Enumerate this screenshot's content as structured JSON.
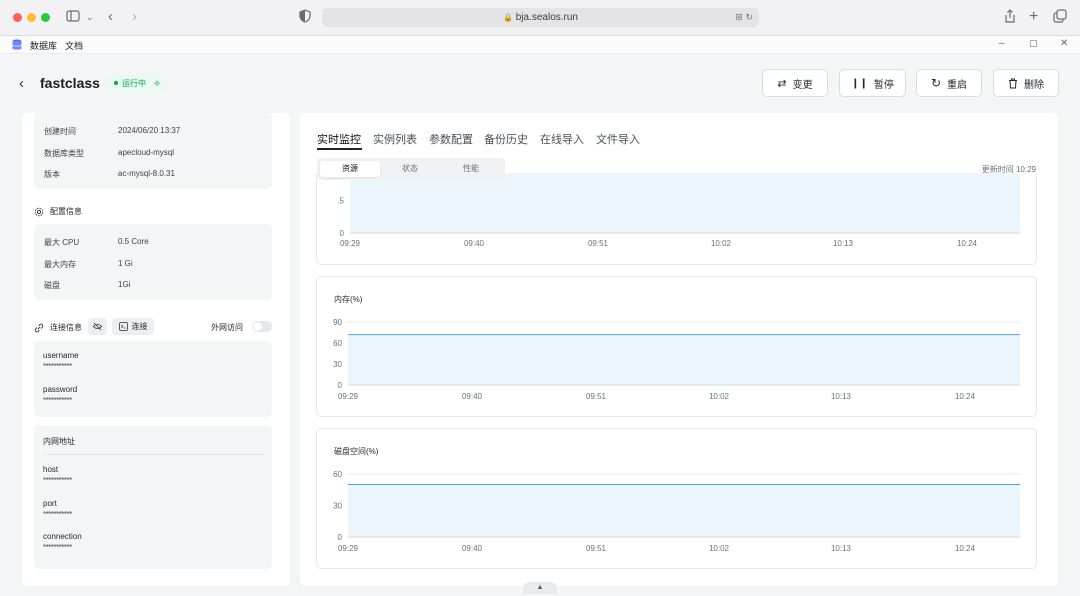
{
  "browser": {
    "url": "bja.sealos.run"
  },
  "appbar": {
    "tab1": "数据库",
    "tab2": "文档"
  },
  "header": {
    "title": "fastclass",
    "status": "运行中",
    "buttons": {
      "change": "变更",
      "pause": "暂停",
      "restart": "重启",
      "delete": "删除"
    }
  },
  "overview": {
    "rows": [
      {
        "key": "创建时间",
        "value": "2024/06/20 13:37"
      },
      {
        "key": "数据库类型",
        "value": "apecloud-mysql"
      },
      {
        "key": "版本",
        "value": "ac-mysql-8.0.31"
      }
    ]
  },
  "config": {
    "title": "配置信息",
    "rows": [
      {
        "key": "最大 CPU",
        "value": "0.5 Core"
      },
      {
        "key": "最大内存",
        "value": "1 Gi"
      },
      {
        "key": "磁盘",
        "value": "1Gi"
      }
    ]
  },
  "connection": {
    "title": "连接信息",
    "connect_label": "连接",
    "external_label": "外网访问",
    "external_enabled": false,
    "creds": [
      {
        "key": "username",
        "value": "***********"
      },
      {
        "key": "password",
        "value": "***********"
      }
    ],
    "internal_title": "内网地址",
    "internal": [
      {
        "key": "host",
        "value": "***********"
      },
      {
        "key": "port",
        "value": "***********"
      },
      {
        "key": "connection",
        "value": "***********"
      }
    ]
  },
  "monitor": {
    "tabs": [
      "实时监控",
      "实例列表",
      "参数配置",
      "备份历史",
      "在线导入",
      "文件导入"
    ],
    "active_tab": 0,
    "segments": [
      "资源",
      "状态",
      "性能"
    ],
    "active_segment": 0,
    "updated": "更新时间 10:29"
  },
  "chart_data": [
    {
      "type": "area",
      "title": "",
      "x_ticks": [
        "09:29",
        "09:40",
        "09:51",
        "10:02",
        "10:13",
        "10:24"
      ],
      "y_ticks": [
        "0",
        ".5",
        "1"
      ],
      "ylim": [
        0,
        1.1
      ],
      "values": [
        1.0,
        1.02,
        1.01,
        1.03,
        1.0,
        1.02,
        1.01,
        1.02,
        1.0,
        1.01,
        1.02,
        1.01,
        1.0,
        1.03,
        1.02,
        1.01,
        1.02,
        1.0,
        1.01,
        1.03,
        1.05,
        1.02,
        1.01,
        1.03,
        1.02,
        1.0,
        1.01,
        1.02,
        1.0,
        1.01,
        1.02,
        1.04,
        1.01,
        1.02,
        1.0,
        1.01,
        1.02,
        1.01,
        1.03,
        1.02,
        1.0,
        1.02,
        1.01,
        1.02,
        1.0,
        1.01,
        1.02,
        1.04,
        1.01,
        1.03,
        1.0,
        1.01,
        1.0,
        1.02,
        1.01,
        1.02,
        1.03,
        1.0,
        1.02,
        1.01,
        1.03,
        1.02,
        1.04,
        1.01,
        1.02,
        1.0,
        1.01,
        1.03,
        1.05,
        1.02,
        1.04,
        1.06,
        1.03,
        1.04,
        1.06,
        1.04,
        1.01,
        0.97,
        0.99,
        1.02,
        0.98,
        1.01,
        0.96,
        0.98,
        1.0,
        1.03,
        1.0,
        1.04,
        1.01,
        1.0,
        1.02
      ]
    },
    {
      "type": "area",
      "title": "内存(%)",
      "x_ticks": [
        "09:29",
        "09:40",
        "09:51",
        "10:02",
        "10:13",
        "10:24"
      ],
      "y_ticks": [
        "0",
        "30",
        "60",
        "90"
      ],
      "ylim": [
        0,
        90
      ],
      "values": [
        72,
        72
      ]
    },
    {
      "type": "area",
      "title": "磁盘空间(%)",
      "x_ticks": [
        "09:29",
        "09:40",
        "09:51",
        "10:02",
        "10:13",
        "10:24"
      ],
      "y_ticks": [
        "0",
        "30",
        "60"
      ],
      "ylim": [
        0,
        60
      ],
      "values": [
        50,
        50
      ]
    }
  ]
}
